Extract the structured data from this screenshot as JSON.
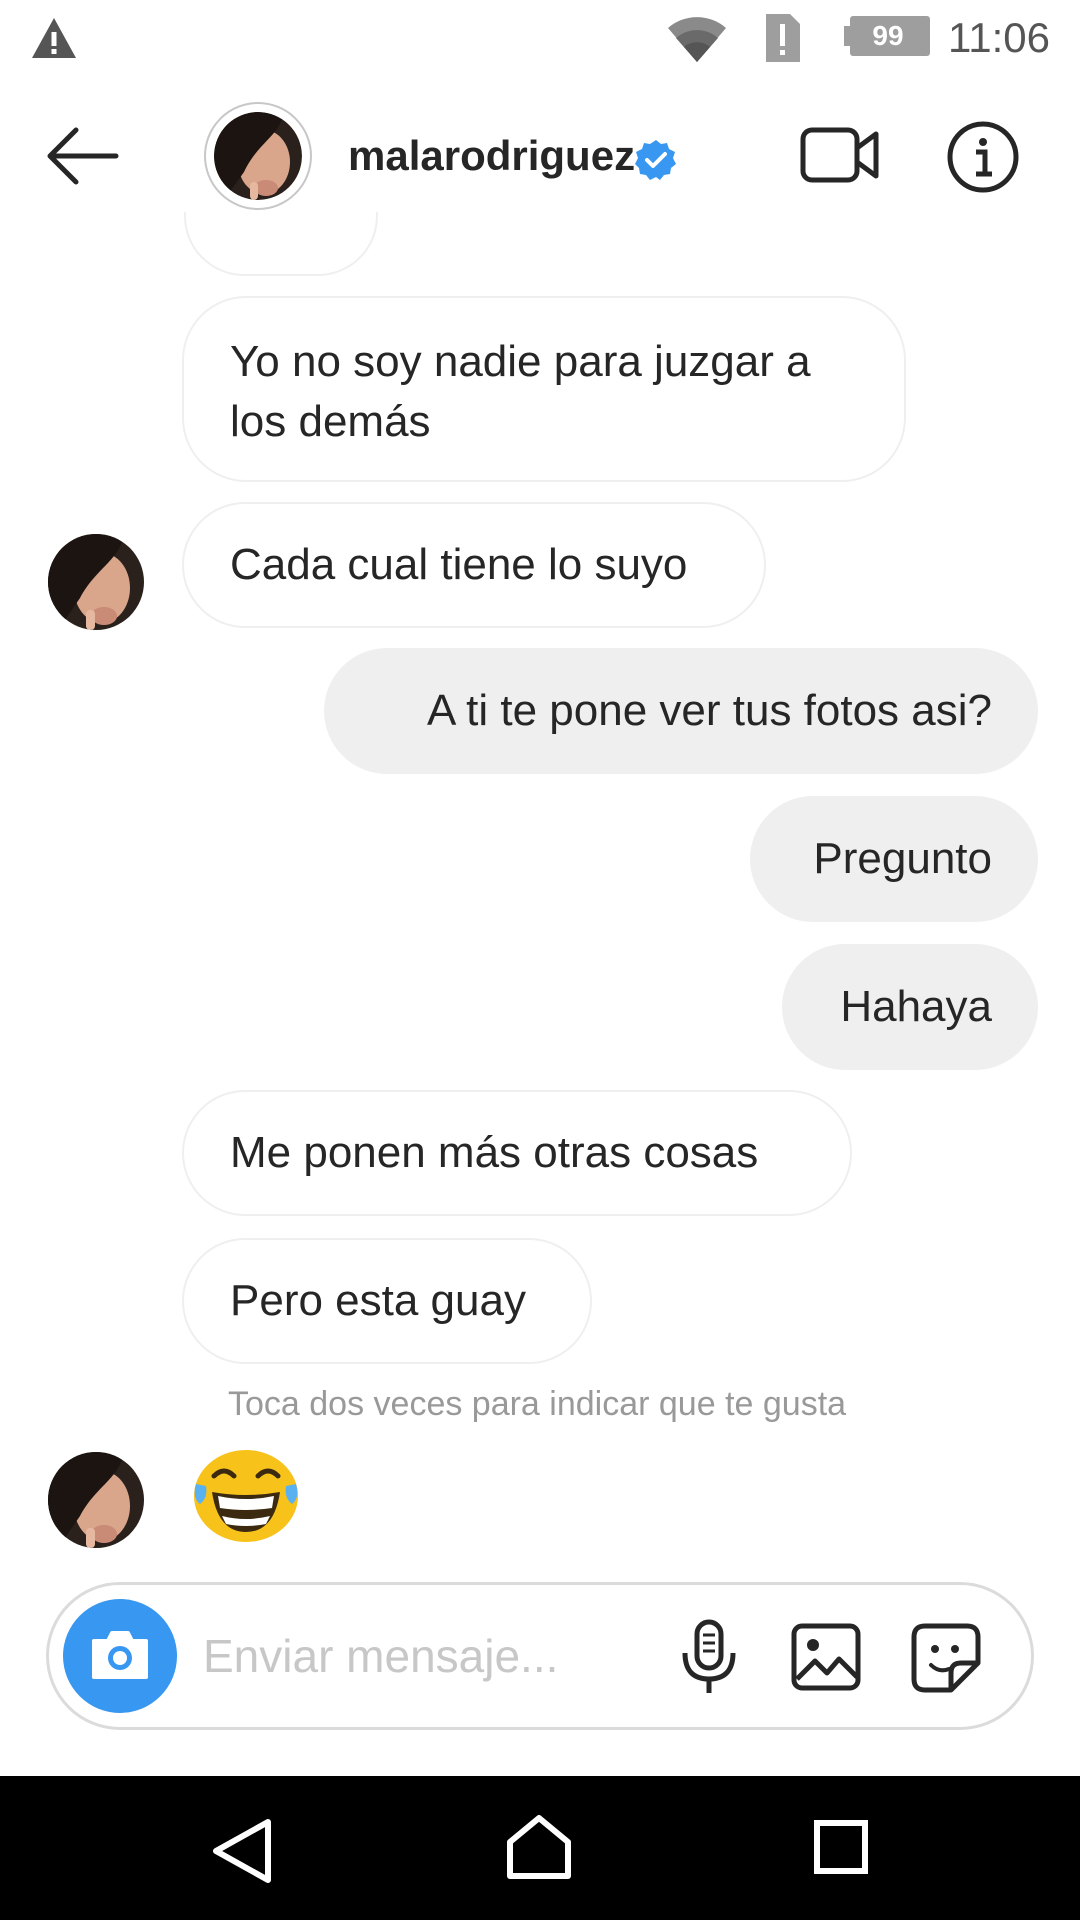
{
  "status_bar": {
    "battery": "99 %",
    "time": "11:06"
  },
  "header": {
    "username": "malarodriguez",
    "verified": true,
    "verified_color": "#3897f0"
  },
  "messages": [
    {
      "direction": "incoming",
      "text": "Yo no soy nadie para juzgar a los demás"
    },
    {
      "direction": "incoming",
      "text": "Cada cual tiene lo suyo"
    },
    {
      "direction": "outgoing",
      "text": "A ti te pone ver tus fotos asi?"
    },
    {
      "direction": "outgoing",
      "text": "Pregunto"
    },
    {
      "direction": "outgoing",
      "text": "Hahaya"
    },
    {
      "direction": "incoming",
      "text": "Me ponen más otras cosas"
    },
    {
      "direction": "incoming",
      "text": "Pero esta guay"
    },
    {
      "direction": "incoming",
      "emoji": "face-with-tears-of-joy"
    }
  ],
  "hint": "Toca dos veces para indicar que te gusta",
  "composer": {
    "placeholder": "Enviar mensaje...",
    "accent": "#3897f0"
  },
  "icons": [
    "warning-icon",
    "wifi-icon",
    "sim-alert-icon",
    "battery-icon",
    "back-arrow-icon",
    "verified-badge-icon",
    "video-call-icon",
    "info-icon",
    "camera-icon",
    "microphone-icon",
    "gallery-icon",
    "sticker-icon",
    "nav-back-icon",
    "nav-home-icon",
    "nav-recents-icon"
  ]
}
